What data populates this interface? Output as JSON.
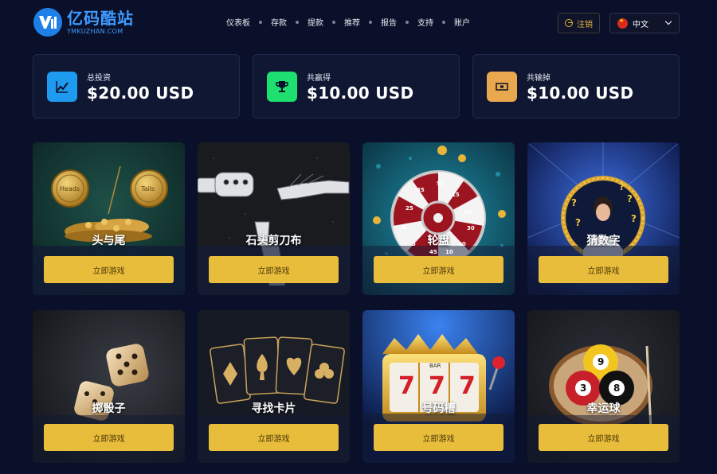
{
  "header": {
    "logo_cn": "亿码酷站",
    "logo_en": "YMKUZHAN.COM",
    "nav": [
      "仪表板",
      "存款",
      "提款",
      "推荐",
      "报告",
      "支持",
      "账户"
    ],
    "logout_label": "注销",
    "language": "中文"
  },
  "stats": [
    {
      "label": "总投资",
      "value": "$20.00 USD",
      "color": "#1e9bf0",
      "icon": "chart-icon"
    },
    {
      "label": "共赢得",
      "value": "$10.00 USD",
      "color": "#1ee070",
      "icon": "trophy-icon"
    },
    {
      "label": "共输掉",
      "value": "$10.00 USD",
      "color": "#e9a74e",
      "icon": "cash-icon"
    }
  ],
  "games": [
    {
      "title": "头与尾",
      "button": "立即游戏",
      "coin_heads": "Heads",
      "coin_tails": "Tails"
    },
    {
      "title": "石头剪刀布",
      "button": "立即游戏"
    },
    {
      "title": "轮盘",
      "button": "立即游戏",
      "wheel_numbers": [
        "0",
        "5",
        "10",
        "15",
        "20",
        "25",
        "30",
        "35",
        "40",
        "45",
        "50"
      ]
    },
    {
      "title": "猜数字",
      "button": "立即游戏"
    },
    {
      "title": "掷骰子",
      "button": "立即游戏"
    },
    {
      "title": "寻找卡片",
      "button": "立即游戏"
    },
    {
      "title": "号码槽",
      "button": "立即游戏",
      "slot_digits": [
        "7",
        "7",
        "7"
      ],
      "slot_label": "BAR"
    },
    {
      "title": "幸运球",
      "button": "立即游戏",
      "balls": [
        "9",
        "3",
        "8"
      ]
    }
  ]
}
